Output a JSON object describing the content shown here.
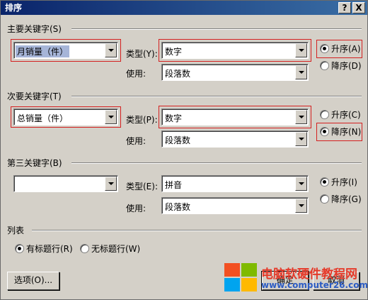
{
  "window": {
    "title": "排序",
    "help_label": "?",
    "close_label": "X"
  },
  "primary": {
    "heading": "主要关键字(S)",
    "field_value": "月销量（件）",
    "type_label": "类型(Y):",
    "type_value": "数字",
    "using_label": "使用:",
    "using_value": "段落数",
    "asc_label": "升序(A)",
    "desc_label": "降序(D)",
    "order": "asc"
  },
  "secondary": {
    "heading": "次要关键字(T)",
    "field_value": "总销量（件）",
    "type_label": "类型(P):",
    "type_value": "数字",
    "using_label": "使用:",
    "using_value": "段落数",
    "asc_label": "升序(C)",
    "desc_label": "降序(N)",
    "order": "desc"
  },
  "tertiary": {
    "heading": "第三关键字(B)",
    "field_value": "",
    "type_label": "类型(E):",
    "type_value": "拼音",
    "using_label": "使用:",
    "using_value": "段落数",
    "asc_label": "升序(I)",
    "desc_label": "降序(G)",
    "order": "asc"
  },
  "list": {
    "heading": "列表",
    "with_header_label": "有标题行(R)",
    "without_header_label": "无标题行(W)",
    "selected": "with_header"
  },
  "buttons": {
    "options_label": "选项(O)...",
    "ok_label": "确定",
    "cancel_label": "取消"
  },
  "watermark": {
    "title": "电脑软硬件教程网",
    "url": "www.computer26.com",
    "logo_colors": [
      "#f25022",
      "#7fba00",
      "#00a4ef",
      "#ffb900"
    ]
  },
  "colors": {
    "title_bar": "#0a246a",
    "highlight_box": "#d42020",
    "dialog_bg": "#d4d0c8"
  }
}
